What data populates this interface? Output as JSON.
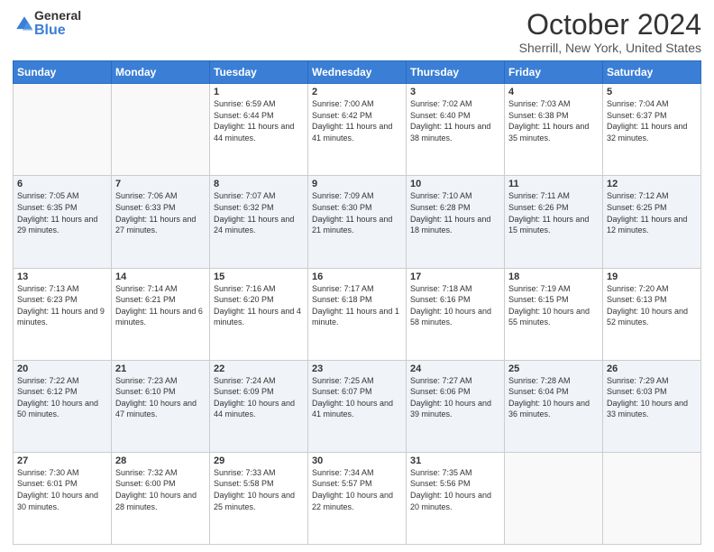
{
  "logo": {
    "general": "General",
    "blue": "Blue"
  },
  "title": "October 2024",
  "location": "Sherrill, New York, United States",
  "days_of_week": [
    "Sunday",
    "Monday",
    "Tuesday",
    "Wednesday",
    "Thursday",
    "Friday",
    "Saturday"
  ],
  "weeks": [
    [
      {
        "day": "",
        "content": ""
      },
      {
        "day": "",
        "content": ""
      },
      {
        "day": "1",
        "content": "Sunrise: 6:59 AM\nSunset: 6:44 PM\nDaylight: 11 hours and 44 minutes."
      },
      {
        "day": "2",
        "content": "Sunrise: 7:00 AM\nSunset: 6:42 PM\nDaylight: 11 hours and 41 minutes."
      },
      {
        "day": "3",
        "content": "Sunrise: 7:02 AM\nSunset: 6:40 PM\nDaylight: 11 hours and 38 minutes."
      },
      {
        "day": "4",
        "content": "Sunrise: 7:03 AM\nSunset: 6:38 PM\nDaylight: 11 hours and 35 minutes."
      },
      {
        "day": "5",
        "content": "Sunrise: 7:04 AM\nSunset: 6:37 PM\nDaylight: 11 hours and 32 minutes."
      }
    ],
    [
      {
        "day": "6",
        "content": "Sunrise: 7:05 AM\nSunset: 6:35 PM\nDaylight: 11 hours and 29 minutes."
      },
      {
        "day": "7",
        "content": "Sunrise: 7:06 AM\nSunset: 6:33 PM\nDaylight: 11 hours and 27 minutes."
      },
      {
        "day": "8",
        "content": "Sunrise: 7:07 AM\nSunset: 6:32 PM\nDaylight: 11 hours and 24 minutes."
      },
      {
        "day": "9",
        "content": "Sunrise: 7:09 AM\nSunset: 6:30 PM\nDaylight: 11 hours and 21 minutes."
      },
      {
        "day": "10",
        "content": "Sunrise: 7:10 AM\nSunset: 6:28 PM\nDaylight: 11 hours and 18 minutes."
      },
      {
        "day": "11",
        "content": "Sunrise: 7:11 AM\nSunset: 6:26 PM\nDaylight: 11 hours and 15 minutes."
      },
      {
        "day": "12",
        "content": "Sunrise: 7:12 AM\nSunset: 6:25 PM\nDaylight: 11 hours and 12 minutes."
      }
    ],
    [
      {
        "day": "13",
        "content": "Sunrise: 7:13 AM\nSunset: 6:23 PM\nDaylight: 11 hours and 9 minutes."
      },
      {
        "day": "14",
        "content": "Sunrise: 7:14 AM\nSunset: 6:21 PM\nDaylight: 11 hours and 6 minutes."
      },
      {
        "day": "15",
        "content": "Sunrise: 7:16 AM\nSunset: 6:20 PM\nDaylight: 11 hours and 4 minutes."
      },
      {
        "day": "16",
        "content": "Sunrise: 7:17 AM\nSunset: 6:18 PM\nDaylight: 11 hours and 1 minute."
      },
      {
        "day": "17",
        "content": "Sunrise: 7:18 AM\nSunset: 6:16 PM\nDaylight: 10 hours and 58 minutes."
      },
      {
        "day": "18",
        "content": "Sunrise: 7:19 AM\nSunset: 6:15 PM\nDaylight: 10 hours and 55 minutes."
      },
      {
        "day": "19",
        "content": "Sunrise: 7:20 AM\nSunset: 6:13 PM\nDaylight: 10 hours and 52 minutes."
      }
    ],
    [
      {
        "day": "20",
        "content": "Sunrise: 7:22 AM\nSunset: 6:12 PM\nDaylight: 10 hours and 50 minutes."
      },
      {
        "day": "21",
        "content": "Sunrise: 7:23 AM\nSunset: 6:10 PM\nDaylight: 10 hours and 47 minutes."
      },
      {
        "day": "22",
        "content": "Sunrise: 7:24 AM\nSunset: 6:09 PM\nDaylight: 10 hours and 44 minutes."
      },
      {
        "day": "23",
        "content": "Sunrise: 7:25 AM\nSunset: 6:07 PM\nDaylight: 10 hours and 41 minutes."
      },
      {
        "day": "24",
        "content": "Sunrise: 7:27 AM\nSunset: 6:06 PM\nDaylight: 10 hours and 39 minutes."
      },
      {
        "day": "25",
        "content": "Sunrise: 7:28 AM\nSunset: 6:04 PM\nDaylight: 10 hours and 36 minutes."
      },
      {
        "day": "26",
        "content": "Sunrise: 7:29 AM\nSunset: 6:03 PM\nDaylight: 10 hours and 33 minutes."
      }
    ],
    [
      {
        "day": "27",
        "content": "Sunrise: 7:30 AM\nSunset: 6:01 PM\nDaylight: 10 hours and 30 minutes."
      },
      {
        "day": "28",
        "content": "Sunrise: 7:32 AM\nSunset: 6:00 PM\nDaylight: 10 hours and 28 minutes."
      },
      {
        "day": "29",
        "content": "Sunrise: 7:33 AM\nSunset: 5:58 PM\nDaylight: 10 hours and 25 minutes."
      },
      {
        "day": "30",
        "content": "Sunrise: 7:34 AM\nSunset: 5:57 PM\nDaylight: 10 hours and 22 minutes."
      },
      {
        "day": "31",
        "content": "Sunrise: 7:35 AM\nSunset: 5:56 PM\nDaylight: 10 hours and 20 minutes."
      },
      {
        "day": "",
        "content": ""
      },
      {
        "day": "",
        "content": ""
      }
    ]
  ]
}
